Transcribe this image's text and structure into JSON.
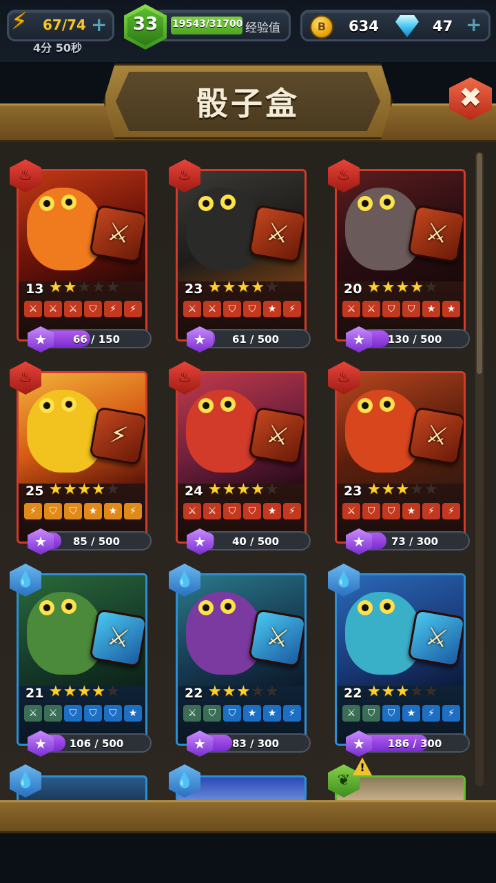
{
  "hud": {
    "energy": "67/74",
    "energy_timer": "4分 50秒",
    "level": "33",
    "xp": "19543/31700",
    "xp_label": "经验值",
    "coins": "634",
    "gems": "47",
    "energy_icon": "lightning-bolt-icon",
    "coin_icon": "coin-icon",
    "gem_icon": "diamond-icon",
    "plus_icon": "plus-icon"
  },
  "title": "骰子盒",
  "close_icon": "close-x-icon",
  "colors": {
    "fire_border": "#d23a2a",
    "water_border": "#2b8fd6",
    "nature_border": "#5fbf2a",
    "xp_green": "#7ed043",
    "progress_purple": "#9a43e0",
    "star_gold": "#ffd02a"
  },
  "cards": [
    {
      "element": "fire",
      "level": "13",
      "stars": 2,
      "progress": "66 / 150",
      "fill": 0.44,
      "faces": [
        "sword",
        "sword",
        "sword",
        "shield",
        "bolt",
        "bolt"
      ]
    },
    {
      "element": "fire",
      "level": "23",
      "stars": 4,
      "progress": "61 / 500",
      "fill": 0.12,
      "faces": [
        "sword",
        "sword",
        "shield",
        "shield",
        "star",
        "bolt"
      ]
    },
    {
      "element": "fire",
      "level": "20",
      "stars": 4,
      "progress": "130 / 500",
      "fill": 0.26,
      "faces": [
        "sword",
        "sword",
        "shield",
        "shield",
        "star",
        "star"
      ]
    },
    {
      "element": "fire",
      "level": "25",
      "stars": 4,
      "progress": "85 / 500",
      "fill": 0.17,
      "faces": [
        "bolt",
        "shield",
        "shield",
        "star",
        "star",
        "bolt"
      ]
    },
    {
      "element": "fire",
      "level": "24",
      "stars": 4,
      "progress": "40 / 500",
      "fill": 0.08,
      "faces": [
        "sword",
        "sword",
        "shield",
        "shield",
        "star",
        "bolt"
      ]
    },
    {
      "element": "fire",
      "level": "23",
      "stars": 3,
      "progress": "73 / 300",
      "fill": 0.24,
      "faces": [
        "sword",
        "shield",
        "shield",
        "star",
        "bolt",
        "bolt"
      ]
    },
    {
      "element": "water",
      "level": "21",
      "stars": 4,
      "progress": "106 / 500",
      "fill": 0.21,
      "faces": [
        "sword",
        "sword",
        "shield",
        "shield",
        "shield",
        "star"
      ]
    },
    {
      "element": "water",
      "level": "22",
      "stars": 3,
      "progress": "83 / 300",
      "fill": 0.28,
      "faces": [
        "sword",
        "shield",
        "shield",
        "star",
        "star",
        "bolt"
      ]
    },
    {
      "element": "water",
      "level": "22",
      "stars": 3,
      "progress": "186 / 300",
      "fill": 0.62,
      "faces": [
        "sword",
        "shield",
        "shield",
        "star",
        "bolt",
        "bolt"
      ]
    }
  ],
  "partial_cards": [
    {
      "element": "water"
    },
    {
      "element": "water"
    },
    {
      "element": "nature",
      "alert": "!"
    }
  ],
  "face_glyphs": {
    "sword": "⚔",
    "shield": "⛉",
    "bolt": "⚡",
    "star": "★"
  },
  "element_glyphs": {
    "fire": "♨",
    "water": "💧",
    "nature": "❦"
  },
  "gem_glyph": "★"
}
